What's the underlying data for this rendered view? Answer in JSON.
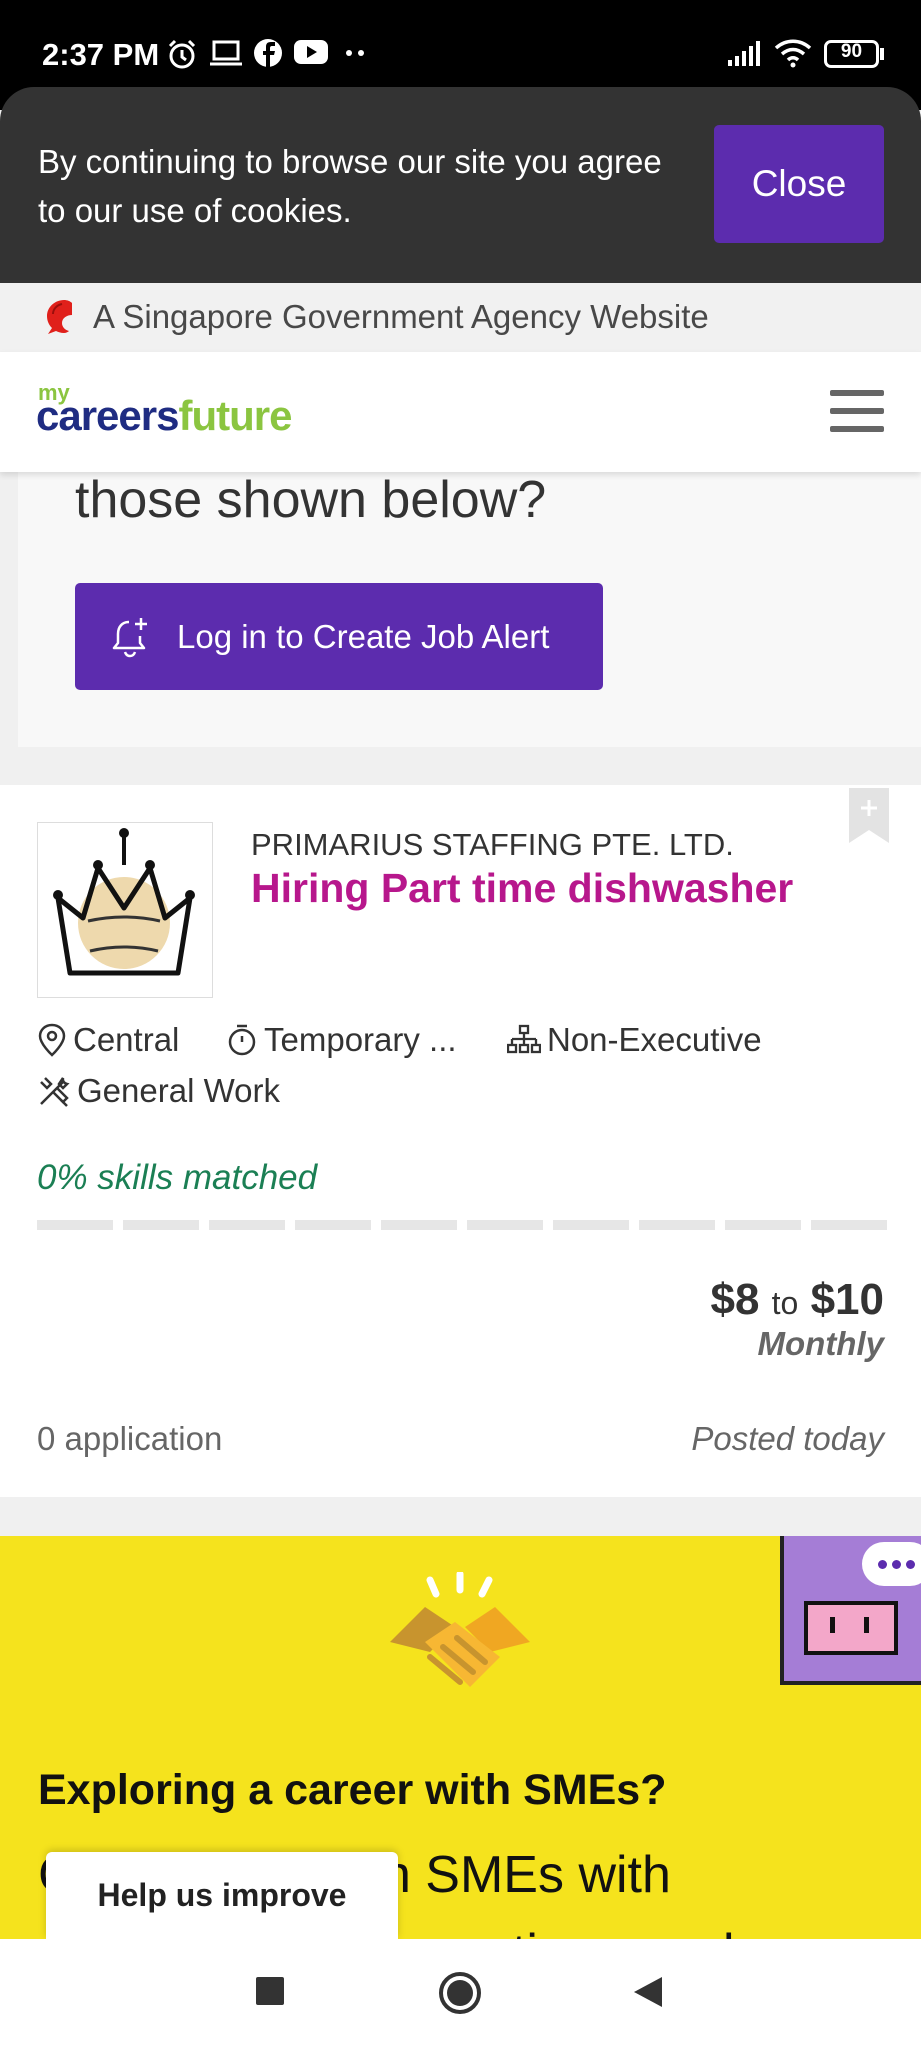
{
  "status_bar": {
    "time": "2:37 PM",
    "battery": "90",
    "icons": [
      "alarm-icon",
      "laptop-icon",
      "facebook-icon",
      "youtube-icon",
      "more-dots-icon",
      "signal-icon",
      "wifi-icon",
      "battery-icon"
    ]
  },
  "cookie_banner": {
    "message": "By continuing to browse our site you agree to our use of cookies.",
    "close_label": "Close"
  },
  "gov_strip": {
    "text": "A Singapore Government Agency Website",
    "icon": "lion-head-icon"
  },
  "header": {
    "logo_my": "my",
    "logo_careers": "careers",
    "logo_future": "future",
    "menu_icon": "hamburger-menu-icon"
  },
  "job_alert": {
    "question": "those shown below?",
    "button_label": "Log in to Create Job Alert",
    "icon": "bell-plus-icon"
  },
  "job": {
    "company": "PRIMARIUS STAFFING PTE. LTD.",
    "title": "Hiring Part time dishwasher",
    "location": "Central",
    "employment_type": "Temporary ...",
    "seniority": "Non-Executive",
    "category": "General Work",
    "skills_matched": "0% skills matched",
    "skills_fraction": 0,
    "salary_min": "$8",
    "salary_to": "to",
    "salary_max": "$10",
    "salary_period": "Monthly",
    "applications": "0 application",
    "posted": "Posted today"
  },
  "sme_banner": {
    "title": "Exploring a career with SMEs?",
    "body": "Consider jobs in SMEs with progressive HR practices, and"
  },
  "help_tab": {
    "label": "Help us improve"
  },
  "colors": {
    "brand_purple": "#5c2cae",
    "job_title_magenta": "#b7178c",
    "match_green": "#1b7f54",
    "logo_navy": "#1f2c82",
    "logo_green": "#8bc540",
    "sme_yellow": "#f5e31d"
  }
}
